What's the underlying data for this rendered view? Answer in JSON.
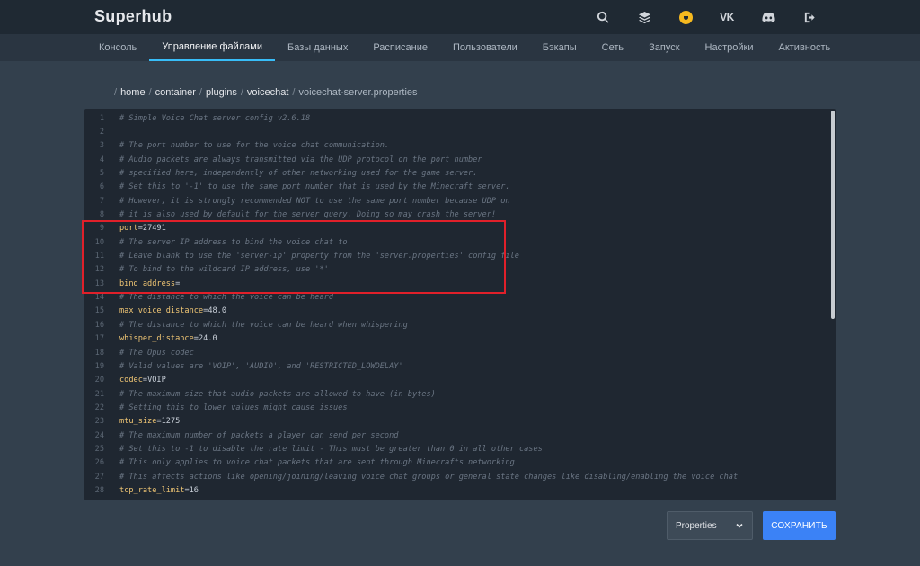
{
  "app": {
    "title": "Superhub"
  },
  "header_icons": [
    {
      "name": "search-icon"
    },
    {
      "name": "layers-icon"
    },
    {
      "name": "avatar-icon"
    },
    {
      "name": "vk-icon",
      "text": "VK"
    },
    {
      "name": "discord-icon"
    },
    {
      "name": "logout-icon"
    }
  ],
  "nav": {
    "items": [
      "Консоль",
      "Управление файлами",
      "Базы данных",
      "Расписание",
      "Пользователи",
      "Бэкапы",
      "Сеть",
      "Запуск",
      "Настройки",
      "Активность"
    ],
    "active": "Управление файлами"
  },
  "breadcrumb": {
    "parts": [
      "home",
      "container",
      "plugins",
      "voicechat"
    ],
    "current": "voicechat-server.properties"
  },
  "editor": {
    "lines": [
      {
        "n": "1",
        "type": "comment",
        "text": "# Simple Voice Chat server config v2.6.18"
      },
      {
        "n": "2",
        "type": "blank",
        "text": ""
      },
      {
        "n": "3",
        "type": "comment",
        "text": "# The port number to use for the voice chat communication."
      },
      {
        "n": "4",
        "type": "comment",
        "text": "# Audio packets are always transmitted via the UDP protocol on the port number"
      },
      {
        "n": "5",
        "type": "comment",
        "text": "# specified here, independently of other networking used for the game server."
      },
      {
        "n": "6",
        "type": "comment",
        "text": "# Set this to '-1' to use the same port number that is used by the Minecraft server."
      },
      {
        "n": "7",
        "type": "comment",
        "text": "# However, it is strongly recommended NOT to use the same port number because UDP on"
      },
      {
        "n": "8",
        "type": "comment",
        "text": "# it is also used by default for the server query. Doing so may crash the server!"
      },
      {
        "n": "9",
        "type": "kv",
        "key": "port",
        "value": "27491"
      },
      {
        "n": "10",
        "type": "comment",
        "text": "# The server IP address to bind the voice chat to"
      },
      {
        "n": "11",
        "type": "comment",
        "text": "# Leave blank to use the 'server-ip' property from the 'server.properties' config file"
      },
      {
        "n": "12",
        "type": "comment",
        "text": "# To bind to the wildcard IP address, use '*'"
      },
      {
        "n": "13",
        "type": "kv",
        "key": "bind_address",
        "value": ""
      },
      {
        "n": "14",
        "type": "comment",
        "text": "# The distance to which the voice can be heard"
      },
      {
        "n": "15",
        "type": "kv",
        "key": "max_voice_distance",
        "value": "48.0"
      },
      {
        "n": "16",
        "type": "comment",
        "text": "# The distance to which the voice can be heard when whispering"
      },
      {
        "n": "17",
        "type": "kv",
        "key": "whisper_distance",
        "value": "24.0"
      },
      {
        "n": "18",
        "type": "comment",
        "text": "# The Opus codec"
      },
      {
        "n": "19",
        "type": "comment",
        "text": "# Valid values are 'VOIP', 'AUDIO', and 'RESTRICTED_LOWDELAY'"
      },
      {
        "n": "20",
        "type": "kv",
        "key": "codec",
        "value": "VOIP"
      },
      {
        "n": "21",
        "type": "comment",
        "text": "# The maximum size that audio packets are allowed to have (in bytes)"
      },
      {
        "n": "22",
        "type": "comment",
        "text": "# Setting this to lower values might cause issues"
      },
      {
        "n": "23",
        "type": "kv",
        "key": "mtu_size",
        "value": "1275"
      },
      {
        "n": "24",
        "type": "comment",
        "text": "# The maximum number of packets a player can send per second"
      },
      {
        "n": "25",
        "type": "comment",
        "text": "# Set this to -1 to disable the rate limit - This must be greater than 0 in all other cases"
      },
      {
        "n": "26",
        "type": "comment",
        "text": "# This only applies to voice chat packets that are sent through Minecrafts networking"
      },
      {
        "n": "27",
        "type": "comment",
        "text": "# This affects actions like opening/joining/leaving voice chat groups or general state changes like disabling/enabling the voice chat"
      },
      {
        "n": "28",
        "type": "kv",
        "key": "tcp_rate_limit",
        "value": "16"
      }
    ]
  },
  "footer": {
    "mode_select": "Properties",
    "save_label": "СОХРАНИТЬ"
  },
  "colors": {
    "accent": "#38bdf8",
    "primary_button": "#3b82f6",
    "highlight_box": "#e0202a",
    "key": "#f0c674"
  }
}
